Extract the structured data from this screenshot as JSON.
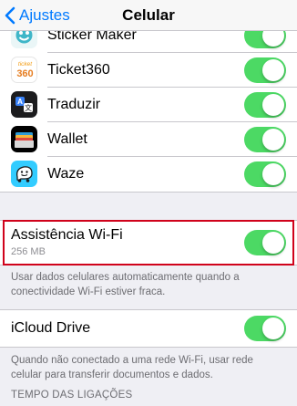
{
  "nav": {
    "back_label": "Ajustes",
    "title": "Celular"
  },
  "apps": [
    {
      "name": "Sticker Maker",
      "icon": "sticker-maker-icon",
      "enabled": true
    },
    {
      "name": "Ticket360",
      "icon": "ticket360-icon",
      "icon_text": "ticket 360",
      "enabled": true
    },
    {
      "name": "Traduzir",
      "icon": "translate-icon",
      "enabled": true
    },
    {
      "name": "Wallet",
      "icon": "wallet-icon",
      "enabled": true
    },
    {
      "name": "Waze",
      "icon": "waze-icon",
      "enabled": true
    }
  ],
  "wifi_assist": {
    "label": "Assistência Wi-Fi",
    "usage": "256 MB",
    "enabled": true,
    "footer": "Usar dados celulares automaticamente quando a conectividade Wi-Fi estiver fraca."
  },
  "icloud_drive": {
    "label": "iCloud Drive",
    "enabled": true,
    "footer": "Quando não conectado a uma rede Wi-Fi, usar rede celular para transferir documentos e dados."
  },
  "call_time_header": "TEMPO DAS LIGAÇÕES",
  "colors": {
    "accent": "#007aff",
    "toggle_on": "#4cd964",
    "highlight": "#d0021b",
    "background": "#efeff4"
  }
}
